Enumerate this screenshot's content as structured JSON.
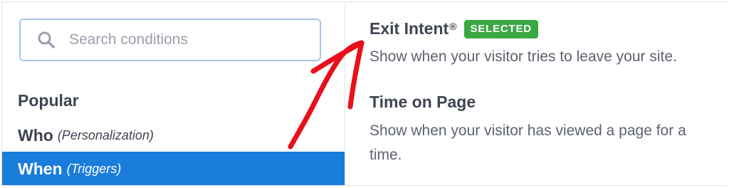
{
  "search": {
    "placeholder": "Search conditions",
    "value": ""
  },
  "sidebar": {
    "section_title": "Popular",
    "items": [
      {
        "label": "Who",
        "sublabel": "(Personalization)",
        "active": false
      },
      {
        "label": "When",
        "sublabel": "(Triggers)",
        "active": true
      }
    ]
  },
  "conditions": [
    {
      "title": "Exit Intent",
      "trademark": "®",
      "badge": "SELECTED",
      "description_lines": [
        "Show when your visitor tries to leave your site."
      ]
    },
    {
      "title": "Time on Page",
      "description_lines": [
        "Show when your visitor has viewed a page for a",
        "time."
      ]
    }
  ],
  "colors": {
    "accent": "#1a7cdb",
    "badge": "#3aa843",
    "annotation_arrow": "#e8101a",
    "search_border": "#a9c3ea"
  },
  "icons": {
    "search": "search-icon",
    "annotation": "hand-drawn-arrow-icon"
  }
}
